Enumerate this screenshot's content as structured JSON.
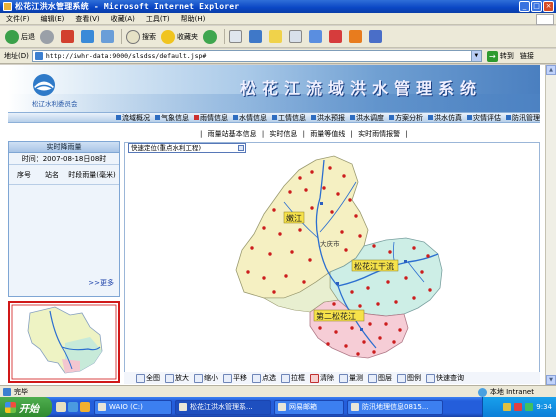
{
  "window": {
    "title": "松花江洪水管理系统 - Microsoft Internet Explorer",
    "buttons": [
      "_",
      "□",
      "×"
    ]
  },
  "menu": [
    "文件(F)",
    "编辑(E)",
    "查看(V)",
    "收藏(A)",
    "工具(T)",
    "帮助(H)"
  ],
  "toolbar": {
    "back": "后退",
    "search": "搜索",
    "favorites": "收藏夹"
  },
  "address": {
    "label": "地址(D)",
    "url": "http://iwhr-data:9000/slsdss/default.jsp#",
    "go": "转到",
    "links": "链接"
  },
  "banner": {
    "org": "松辽水利委员会",
    "system_title": "松花江流域洪水管理系统"
  },
  "nav": [
    "流域概况",
    "气象信息",
    "雨情信息",
    "水情信息",
    "工情信息",
    "洪水预报",
    "洪水调度",
    "方案分析",
    "洪水仿真",
    "灾情评估",
    "防汛管理"
  ],
  "subnav": [
    "雨量站基本信息",
    "实时信息",
    "雨量等值线",
    "实时雨情报警"
  ],
  "left_panel": {
    "header": "实时降雨量",
    "time_label": "时间：",
    "time_value": "2007-08-18日08时",
    "columns": [
      "序号",
      "站名",
      "时段雨量(毫米)"
    ],
    "more": ">>更多"
  },
  "map": {
    "quick_locate": "快速定位(重点水利工程)",
    "labels": {
      "nenjiang": "嫩江",
      "songhua_main": "松花江干流",
      "second_songhua": "第二松花江",
      "dalai": "大庆市"
    }
  },
  "map_tools": [
    "全图",
    "放大",
    "缩小",
    "平移",
    "点选",
    "拉框",
    "清除",
    "量测",
    "图层",
    "图例",
    "快速查询"
  ],
  "status": {
    "text": "完毕",
    "zone": "本地 Intranet"
  },
  "taskbar": {
    "start": "开始",
    "tasks": [
      "WAIO (C:)",
      "松花江洪水管理系...",
      "网易邮箱",
      "防汛地理信息0815..."
    ],
    "clock": "9:34"
  },
  "colors": {
    "title_blue": "#0a46c4",
    "nenjiang_basin": "#f5f0c2",
    "songhua_basin": "#cdeee6",
    "second_songhua_basin": "#f6cdd6",
    "rain_station": "#cc1d1d",
    "river": "#2b6ed0"
  }
}
